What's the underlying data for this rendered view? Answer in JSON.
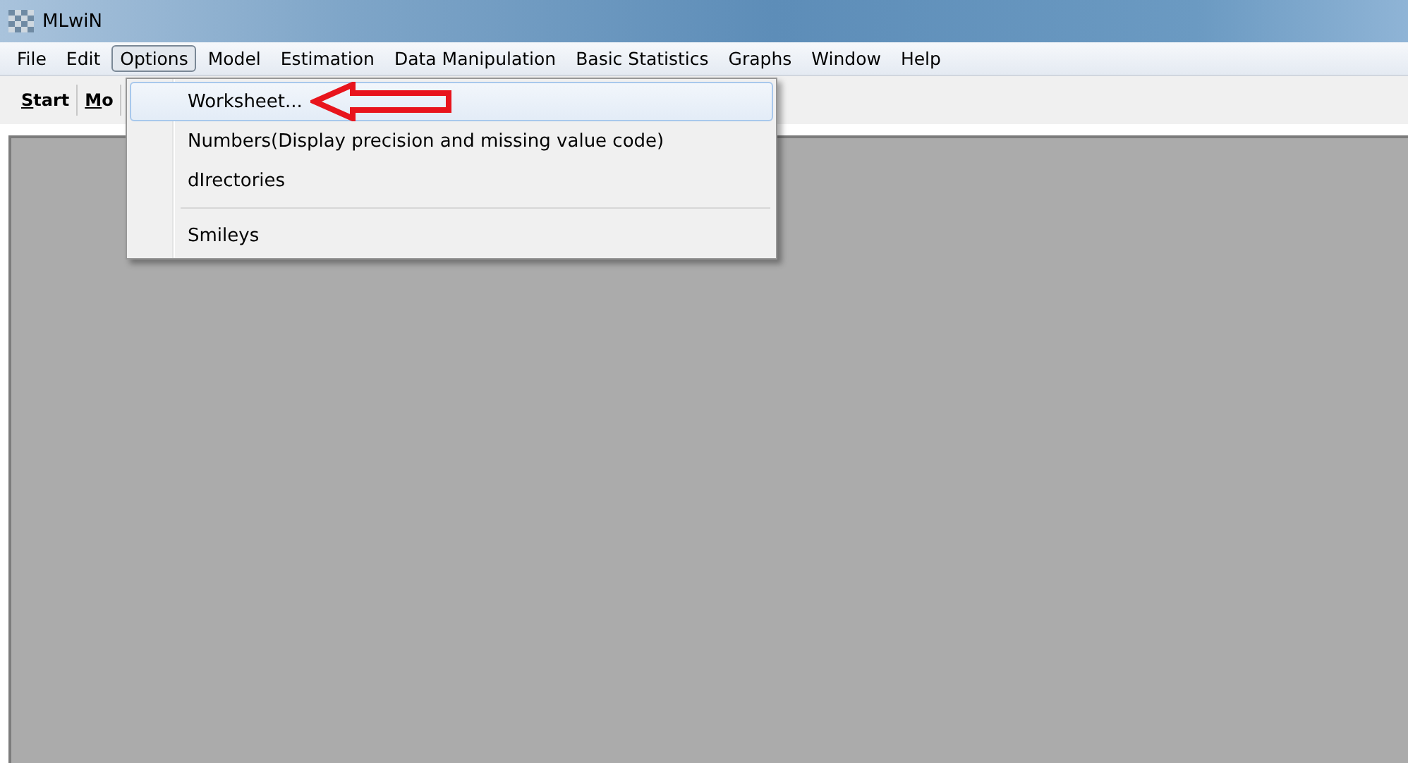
{
  "window": {
    "title": "MLwiN"
  },
  "menu_bar": [
    {
      "label": "File",
      "selected": false
    },
    {
      "label": "Edit",
      "selected": false
    },
    {
      "label": "Options",
      "selected": true
    },
    {
      "label": "Model",
      "selected": false
    },
    {
      "label": "Estimation",
      "selected": false
    },
    {
      "label": "Data Manipulation",
      "selected": false
    },
    {
      "label": "Basic Statistics",
      "selected": false
    },
    {
      "label": "Graphs",
      "selected": false
    },
    {
      "label": "Window",
      "selected": false
    },
    {
      "label": "Help",
      "selected": false
    }
  ],
  "toolbar": [
    "Start",
    "Mo"
  ],
  "options_menu": [
    {
      "kind": "item",
      "label": "Worksheet...",
      "selected": true
    },
    {
      "kind": "item",
      "label": "Numbers(Display precision and missing value code)",
      "selected": false
    },
    {
      "kind": "item",
      "label": "dIrectories",
      "selected": false
    },
    {
      "kind": "separator"
    },
    {
      "kind": "item",
      "label": "Smileys",
      "selected": false
    }
  ]
}
